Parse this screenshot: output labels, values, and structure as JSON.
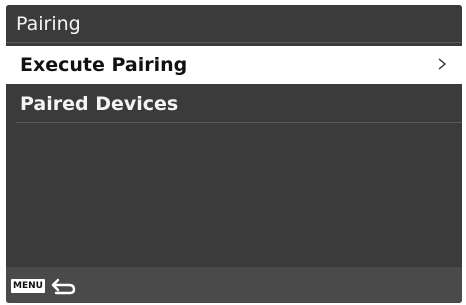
{
  "header": {
    "title": "Pairing"
  },
  "menu": {
    "items": [
      {
        "label": "Execute Pairing",
        "selected": true,
        "has_submenu": true
      },
      {
        "label": "Paired Devices",
        "selected": false,
        "has_submenu": false
      }
    ]
  },
  "footer": {
    "menu_key_label": "MENU",
    "back_icon": "back-arrow-icon"
  },
  "colors": {
    "background": "#3b3b3b",
    "selected_row": "#ffffff",
    "footer": "#4a4a4a",
    "text": "#f4f4f4"
  }
}
